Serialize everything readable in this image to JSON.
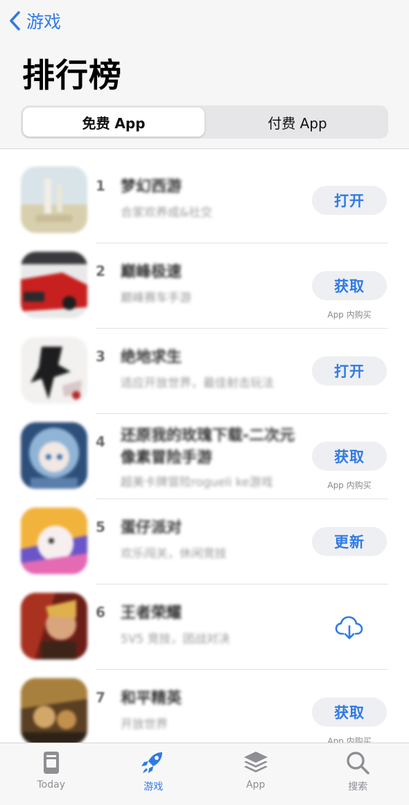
{
  "nav": {
    "back_label": "游戏"
  },
  "page": {
    "title": "排行榜"
  },
  "segments": [
    {
      "label": "免费 App",
      "selected": true
    },
    {
      "label": "付费 App",
      "selected": false
    }
  ],
  "apps": [
    {
      "rank": "1",
      "name": "梦幻西游",
      "subtitle": "合家欢养成&社交",
      "action": "打开",
      "in_app": ""
    },
    {
      "rank": "2",
      "name": "巅峰极速",
      "subtitle": "巅峰赛车手游",
      "action": "获取",
      "in_app": "App 内购买"
    },
    {
      "rank": "3",
      "name": "绝地求生",
      "subtitle": "适应开放世界，最佳射击玩法",
      "action": "打开",
      "in_app": ""
    },
    {
      "rank": "4",
      "name": "还原我的玫瑰下载-二次元像素冒险手游",
      "subtitle": "超美卡牌冒险rogueli ke游戏",
      "action": "获取",
      "in_app": "App 内购买"
    },
    {
      "rank": "5",
      "name": "蛋仔派对",
      "subtitle": "欢乐闯关，休闲竞技",
      "action": "更新",
      "in_app": ""
    },
    {
      "rank": "6",
      "name": "王者荣耀",
      "subtitle": "5V5 竞技，团战对决",
      "action": "",
      "in_app": ""
    },
    {
      "rank": "7",
      "name": "和平精英",
      "subtitle": "开放世界",
      "action": "获取",
      "in_app": "App 内购买"
    }
  ],
  "tabs": [
    {
      "label": "Today",
      "icon": "today-icon",
      "active": false
    },
    {
      "label": "游戏",
      "icon": "rocket-icon",
      "active": true
    },
    {
      "label": "App",
      "icon": "apps-stack-icon",
      "active": false
    },
    {
      "label": "搜索",
      "icon": "search-icon",
      "active": false
    }
  ],
  "colors": {
    "accent": "#2f7ae5",
    "button_bg": "#eeeff3",
    "inactive_tab": "#8e8e93"
  }
}
